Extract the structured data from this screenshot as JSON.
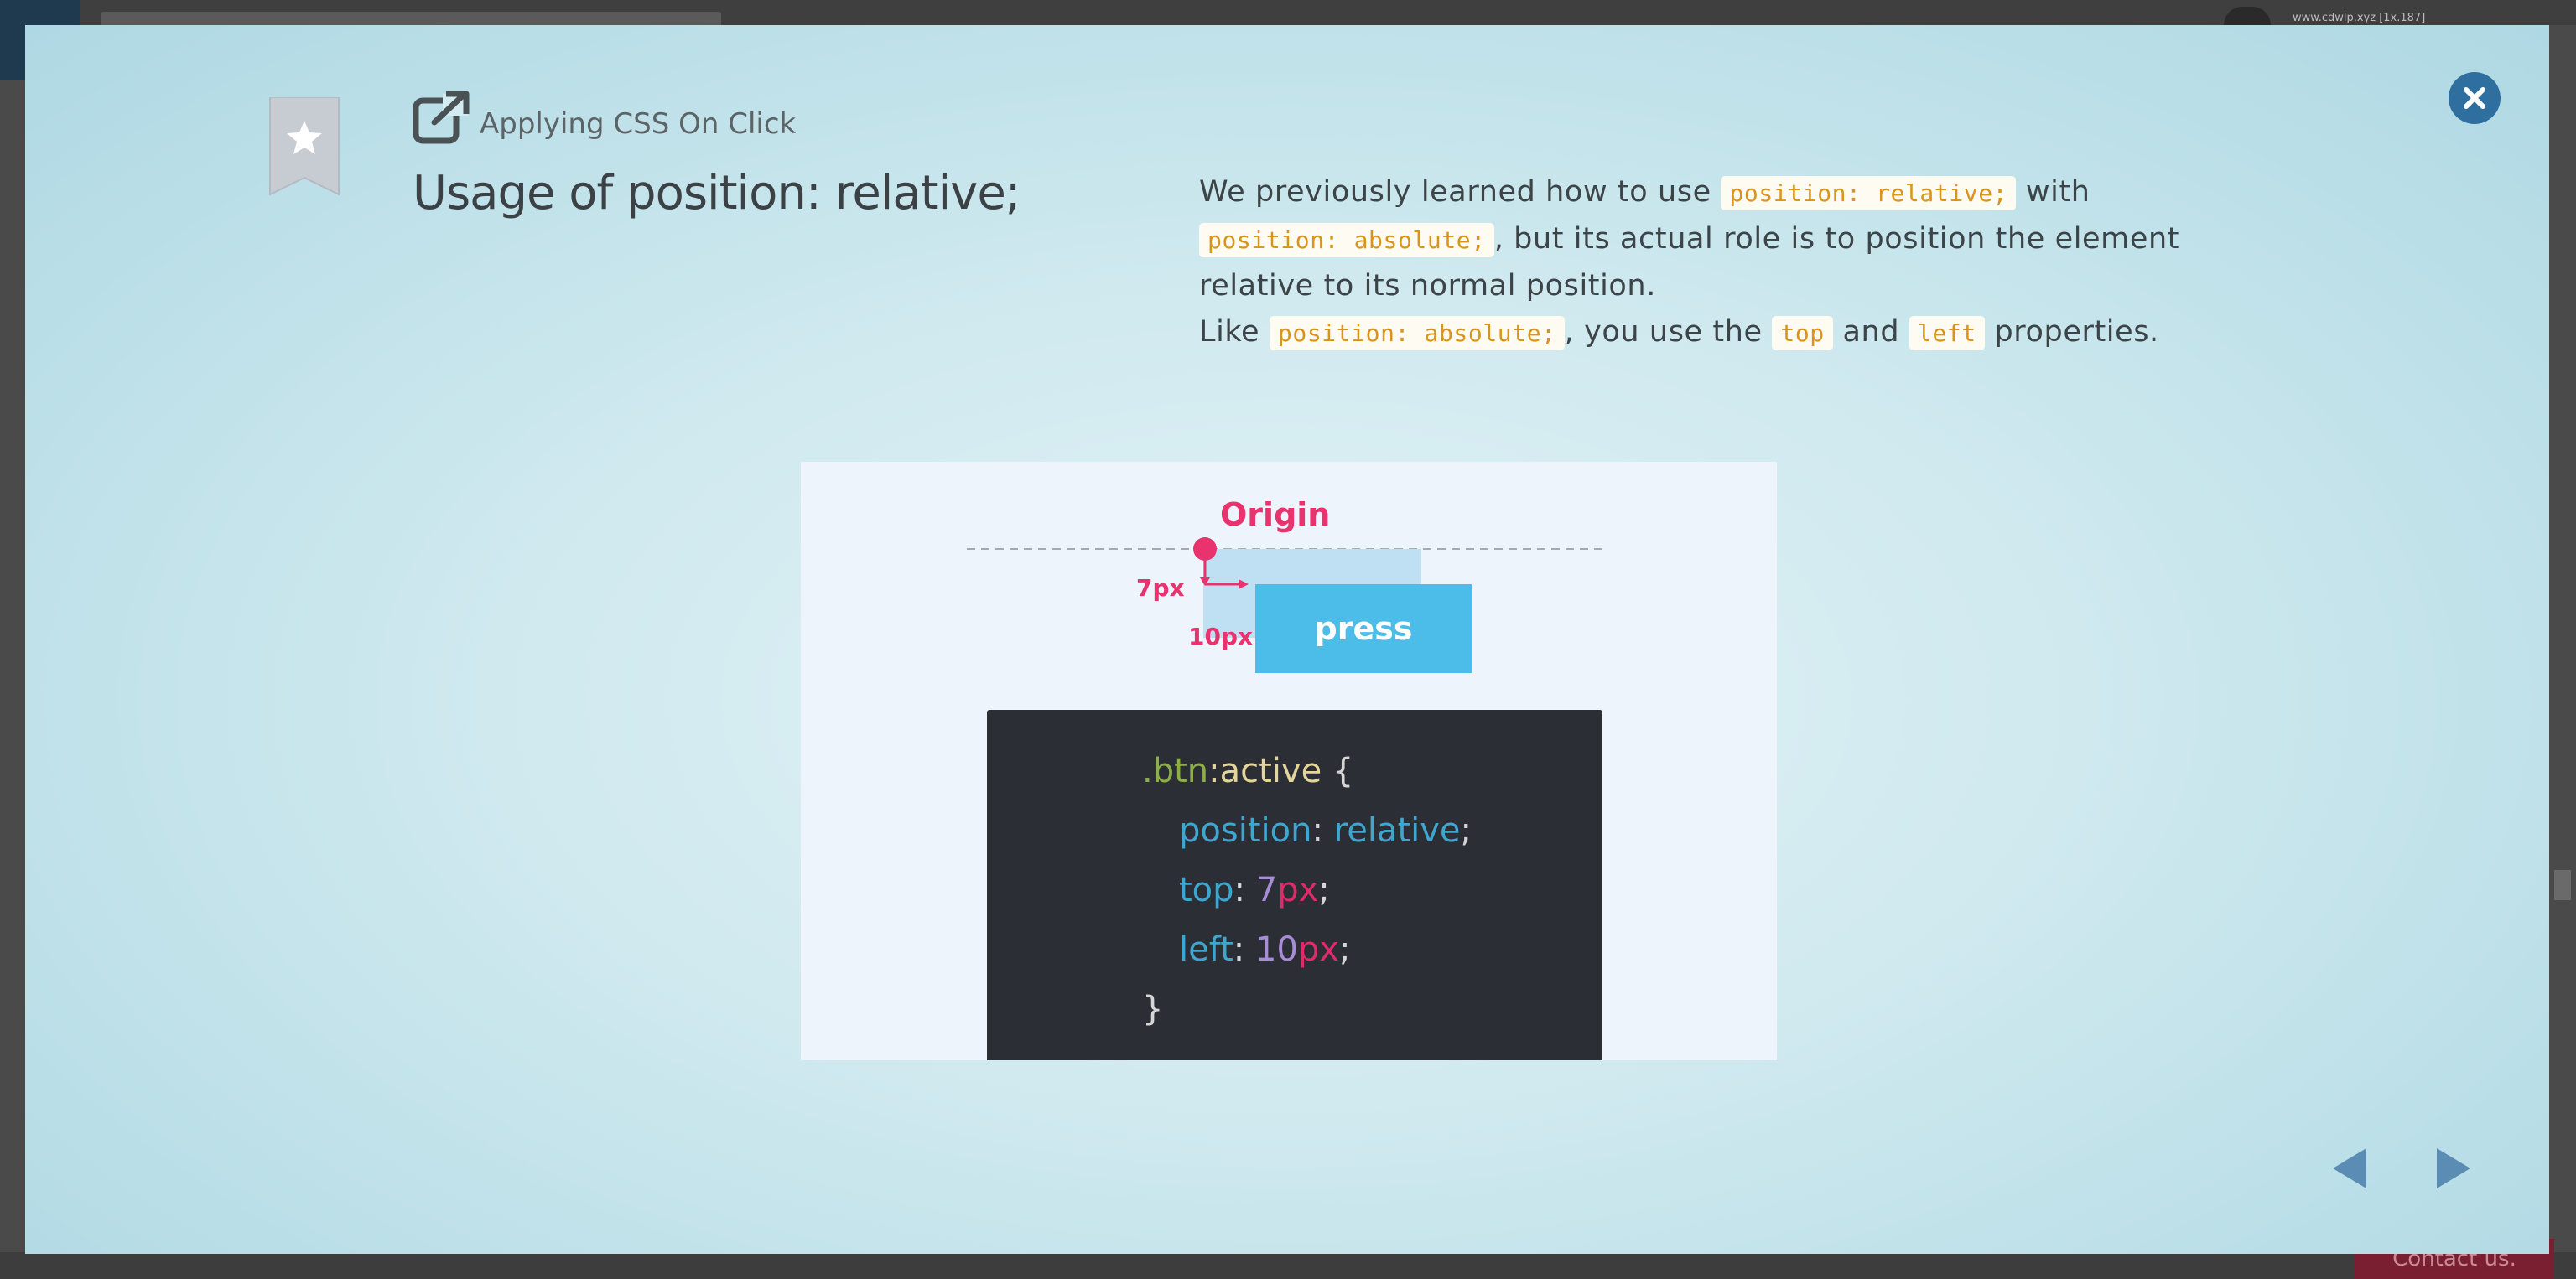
{
  "background_app": {
    "user_label": "www.cdwlp.xyz [1x.187]",
    "contact_label": "Contact us."
  },
  "modal": {
    "section_title": "Applying CSS On Click",
    "heading": "Usage of position: relative;",
    "description": {
      "line1_pre": "We previously learned how to use",
      "code_relative": "position: relative;",
      "line1_post": "with",
      "code_absolute_1": "position: absolute;",
      "line2_post": ", but its actual role is to position the element",
      "line3": "relative to its normal position.",
      "line4_pre": "Like",
      "code_absolute_2": "position: absolute;",
      "line4_mid": ", you use the",
      "code_top": "top",
      "line4_and": "and",
      "code_left": "left",
      "line4_post": "properties."
    },
    "illustration": {
      "origin_label": "Origin",
      "top_offset_label": "7px",
      "left_offset_label": "10px",
      "button_label": "press",
      "code": {
        "selector": ".btn",
        "pseudo": ":active",
        "open_brace": " {",
        "prop1": "position",
        "val1": "relative",
        "prop2": "top",
        "num2": "7",
        "prop3": "left",
        "num3": "10",
        "unit": "px",
        "colon": ": ",
        "semicolon": ";",
        "close_brace": "}"
      }
    }
  },
  "icons": {
    "bookmark": "bookmark-star-icon",
    "section": "external-link-icon",
    "close": "close-icon",
    "prev": "arrow-left-icon",
    "next": "arrow-right-icon"
  },
  "colors": {
    "accent": "#2f6f9f",
    "code_inline": "#d9941c",
    "origin": "#e8336e",
    "button": "#4bbde8"
  }
}
